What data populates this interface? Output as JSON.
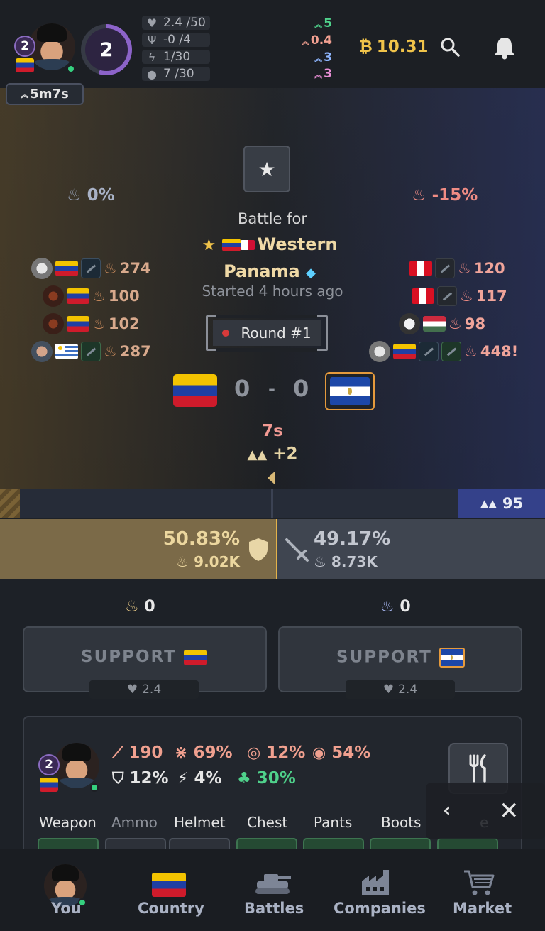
{
  "header": {
    "avatar_level": "2",
    "ring_level": "2",
    "timer_label": "5m7s",
    "stats": [
      {
        "icon": "heart-icon",
        "text": "2.4 /50"
      },
      {
        "icon": "food-icon",
        "text": "-0 /4"
      },
      {
        "icon": "lightning-icon",
        "text": "1/30"
      },
      {
        "icon": "bulb-icon",
        "text": "7 /30"
      }
    ],
    "boosts": [
      {
        "text": "5",
        "color": "#4fd18b"
      },
      {
        "text": "0.4",
        "color": "#f2a091"
      },
      {
        "text": "3",
        "color": "#8fb6ff"
      },
      {
        "text": "3",
        "color": "#e98fd6"
      }
    ],
    "money": "10.31",
    "money_symbol": "₿"
  },
  "battle": {
    "left_pct": "0%",
    "right_pct": "-15%",
    "title": "Battle for",
    "region": "Western Panama",
    "started": "Started 4 hours ago",
    "round": "Round #1",
    "score_left": "0",
    "score_sep": "-",
    "score_right": "0",
    "countdown": "7s",
    "mountain_bonus": "+2",
    "wall_right_value": "95",
    "left_players": [
      {
        "damage": "274"
      },
      {
        "damage": "100"
      },
      {
        "damage": "102"
      },
      {
        "damage": "287"
      }
    ],
    "right_players": [
      {
        "damage": "120"
      },
      {
        "damage": "117"
      },
      {
        "damage": "98"
      },
      {
        "damage": "448!"
      }
    ]
  },
  "split": {
    "left_pct": "50.83%",
    "left_dmg": "9.02K",
    "right_pct": "49.17%",
    "right_dmg": "8.73K",
    "left_share": 0.5083
  },
  "support": {
    "left_dmg": "0",
    "right_dmg": "0",
    "left_label": "SUPPORT",
    "right_label": "SUPPORT",
    "left_hp": "2.4",
    "right_hp": "2.4"
  },
  "profile": {
    "level": "2",
    "attack": "190",
    "precision": "69%",
    "crit": "12%",
    "crit_damage": "54%",
    "armor": "12%",
    "dodge": "4%",
    "luck": "30%",
    "equipment_tabs": [
      "Weapon",
      "Ammo",
      "Helmet",
      "Chest",
      "Pants",
      "Boots",
      "e"
    ]
  },
  "nav": {
    "items": [
      "You",
      "Country",
      "Battles",
      "Companies",
      "Market"
    ]
  },
  "colors": {
    "accent_gold": "#e3b24a",
    "attacker_blue": "#34418a",
    "money": "#f0c34a"
  }
}
